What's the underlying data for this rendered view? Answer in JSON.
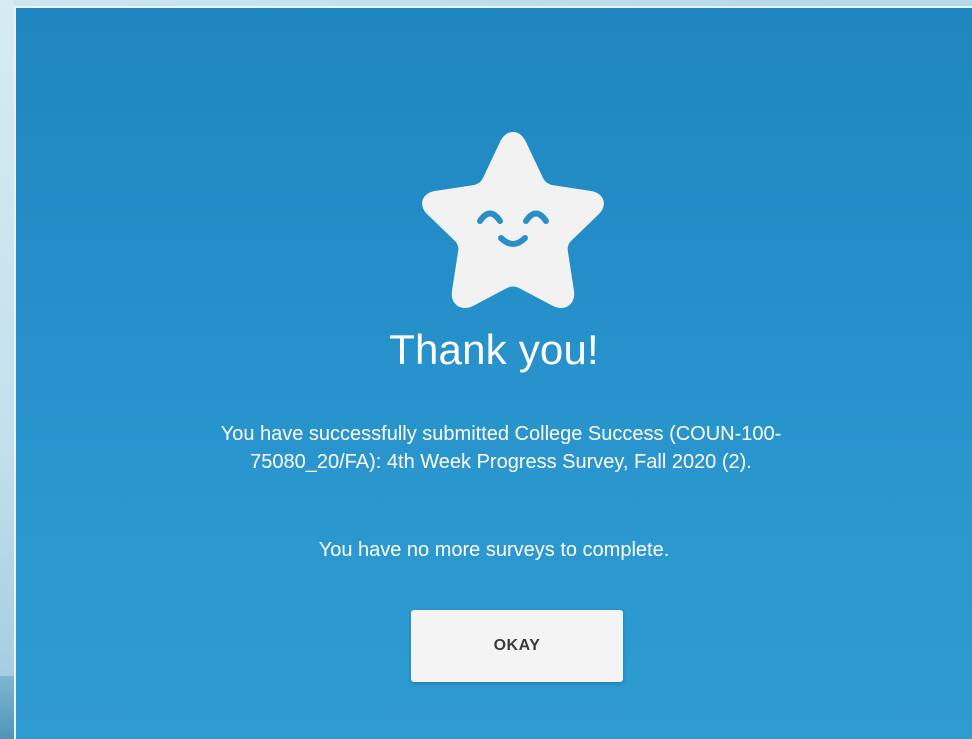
{
  "dialog": {
    "title": "Thank you!",
    "message": "You have successfully submitted College Success (COUN-100-75080_20/FA): 4th Week Progress Survey, Fall 2020 (2).",
    "sub_message": "You have no more surveys to complete.",
    "okay_label": "OKAY",
    "icon": "smiling-star-icon"
  },
  "colors": {
    "background": "#248ec8",
    "star": "#f2f2f2",
    "face": "#2a8fc6",
    "button_bg": "#f4f4f4",
    "button_text": "#3a3a3a"
  }
}
